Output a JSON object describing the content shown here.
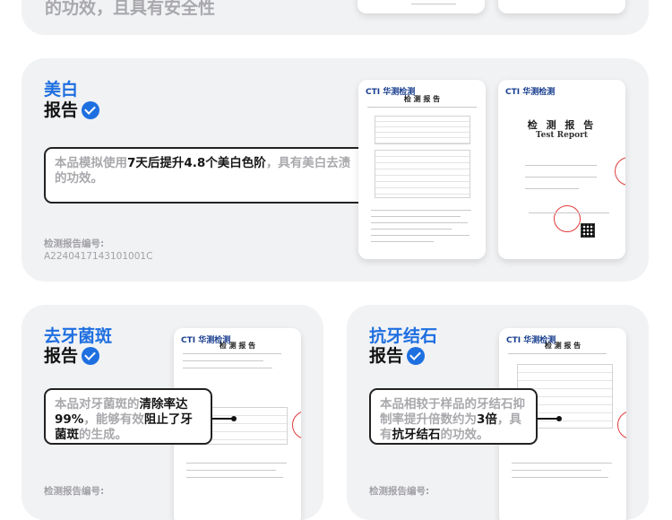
{
  "top_section": {
    "fragment_text": "的功效，且具有安全性"
  },
  "whitening": {
    "title_blue": "美白",
    "title_black": "报告",
    "callout_pre": "本品模拟使用",
    "callout_em": "7天后提升4.8个美白色阶",
    "callout_post": "，具有美白去渍的功效。",
    "report_label": "检测报告编号:",
    "report_number": "A2240417143101001C",
    "doc1_logo": "CTI 华测检测",
    "doc1_heading": "检 测 报 告",
    "doc2_logo": "CTI 华测检测",
    "doc2_title": "检 测 报 告",
    "doc2_subtitle": "Test Report"
  },
  "antibacterial": {
    "title_blue": "去牙菌斑",
    "title_black": "报告",
    "callout_pre": "本品对牙菌斑的",
    "callout_em1": "清除率达99%",
    "callout_mid": "，能够有效",
    "callout_em2": "阻止了牙菌斑",
    "callout_post": "的生成。",
    "report_label": "检测报告编号:",
    "doc_logo": "CTI 华测检测",
    "doc_heading": "检 测 报 告"
  },
  "anticalculus": {
    "title_blue": "抗牙结石",
    "title_black": "报告",
    "callout_pre": "本品相较于样品的牙结石抑制率提升倍数约为",
    "callout_em1": "3倍",
    "callout_mid": "，具有",
    "callout_em2": "抗牙结石",
    "callout_post": "的功效。",
    "report_label": "检测报告编号:",
    "doc_logo": "CTI 华测检测",
    "doc_heading": "检 测 报 告"
  },
  "colors": {
    "accent_blue": "#1e6fe0",
    "card_bg": "#f1f2f4",
    "muted_text": "#a9a9ad"
  }
}
